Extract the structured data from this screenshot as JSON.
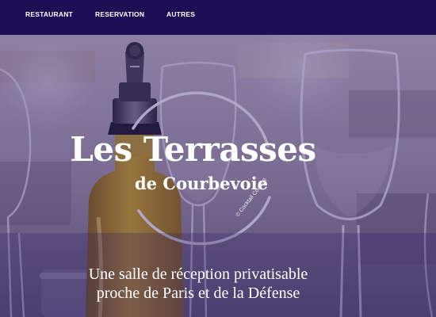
{
  "nav": {
    "items": [
      {
        "label": "RESTAURANT"
      },
      {
        "label": "RESERVATION"
      },
      {
        "label": "AUTRES"
      }
    ]
  },
  "hero": {
    "logo_title": "Les Terrasses",
    "logo_subtitle": "de Courbevoie",
    "copyright": "© Cocktail Cocktail",
    "tagline_line1": "Une salle de réception privatisable",
    "tagline_line2": "proche de Paris et de la Défense"
  },
  "colors": {
    "nav_background": "#1e0d55",
    "overlay_tint": "#30186e",
    "text": "#ffffff"
  }
}
